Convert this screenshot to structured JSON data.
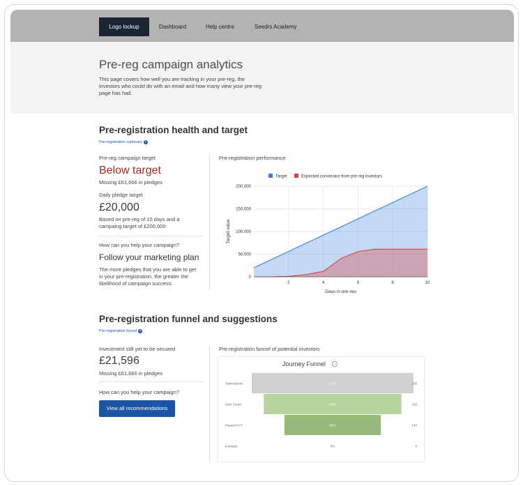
{
  "nav": {
    "logo": "Logo lockup",
    "dashboard": "Dashboard",
    "help": "Help centre",
    "academy": "Seedrs Academy"
  },
  "hero": {
    "title": "Pre-reg campaign analytics",
    "description": "This page covers how well you are tracking in your pre-reg, the investors who could do with an email and how many view your pre-reg page has had."
  },
  "health": {
    "title": "Pre-registration health and target",
    "link": "Pre-registration summary",
    "target_label": "Pre-reg campaign target",
    "target_status": "Below target",
    "target_missing": "Missing £61,666 in pledges",
    "daily_label": "Daily pledge target",
    "daily_value": "£20,000",
    "daily_note": "Based on pre-reg of 10 days and a campaing target of £200,000",
    "help_q": "How can you help your campaign?",
    "help_title": "Follow your marketing plan",
    "help_text": "The more pledges that you are able to get in your pre-registration, the greater the likelihood of campaign success.",
    "chart_caption": "Pre-registration performance"
  },
  "funnel": {
    "title": "Pre-registration funnel and suggestions",
    "link": "Pre-registration funnel",
    "invest_label": "Investment still yet to be secured",
    "invest_value": "£21,596",
    "invest_missing": "Missing £61,666 in pledges",
    "help_q": "How can you help your campaign?",
    "button": "View all recommendations",
    "chart_caption": "Pre-registration funnel of potential investors",
    "card_title": "Journey Funnel"
  },
  "colors": {
    "target": "#3b82e0",
    "expected": "#d8453b",
    "funnel_grey": "#d0d0d0",
    "funnel_light_green": "#b8d49c",
    "funnel_green": "#96bb7a",
    "button": "#1a56a3",
    "below_target": "#a5281b"
  },
  "chart_data": [
    {
      "type": "area",
      "xlabel": "Days in pre-reg",
      "ylabel": "Target value",
      "xlim": [
        0,
        10
      ],
      "ylim": [
        0,
        200000
      ],
      "x_ticks": [
        "2",
        "4",
        "6",
        "8",
        "10"
      ],
      "y_ticks": [
        "0",
        "50,000",
        "100,000",
        "150,000",
        "200,000"
      ],
      "legend_position": "top",
      "grid": true,
      "series": [
        {
          "name": "Target",
          "x": [
            0,
            10
          ],
          "values": [
            20000,
            200000
          ]
        },
        {
          "name": "Expected conversion from pre-reg investors",
          "x": [
            0,
            1,
            2,
            3,
            4,
            5,
            6,
            7,
            8,
            9,
            10
          ],
          "values": [
            0,
            0,
            1000,
            5000,
            12000,
            40000,
            56000,
            61000,
            61000,
            61000,
            61000
          ]
        }
      ]
    },
    {
      "type": "funnel",
      "title": "Journey Funnel",
      "categories": [
        "Submissions",
        "User Count",
        "Passed KYC",
        "Invested"
      ],
      "values": [
        235,
        200,
        140,
        0
      ],
      "value_labels": [
        "235",
        "200",
        "140",
        "0"
      ],
      "percent_labels": [
        "100%",
        "87%",
        "60%",
        "0%"
      ]
    }
  ]
}
